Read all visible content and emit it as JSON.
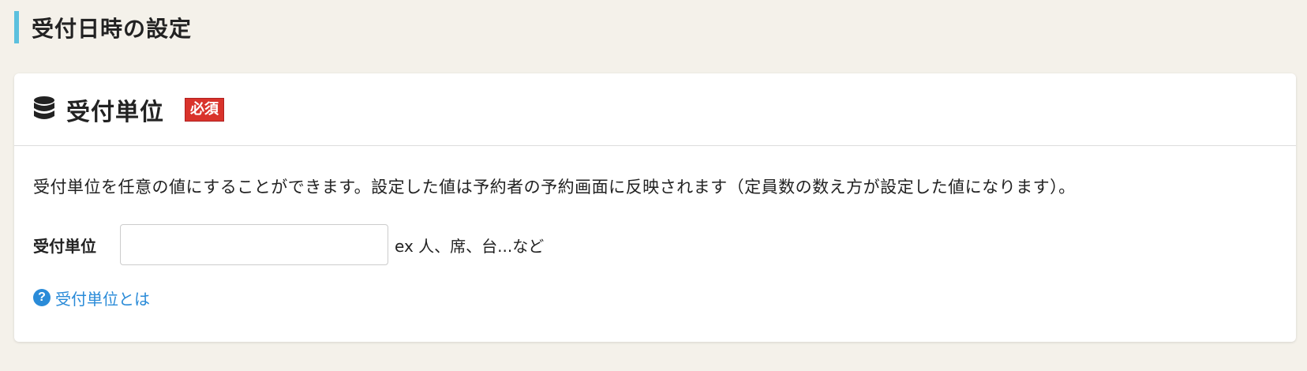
{
  "section": {
    "title": "受付日時の設定"
  },
  "card": {
    "title": "受付単位",
    "required_badge": "必須",
    "icon": "database-icon",
    "description": "受付単位を任意の値にすることができます。設定した値は予約者の予約画面に反映されます（定員数の数え方が設定した値になります）。",
    "field": {
      "label": "受付単位",
      "value": "",
      "placeholder": "",
      "hint": "ex 人、席、台...など"
    },
    "help": {
      "icon": "question-circle-icon",
      "icon_glyph": "?",
      "label": "受付単位とは"
    }
  },
  "colors": {
    "background": "#f4f1ea",
    "accent_bar": "#5bc0de",
    "required_badge": "#d9332b",
    "link": "#2a8bd8"
  }
}
